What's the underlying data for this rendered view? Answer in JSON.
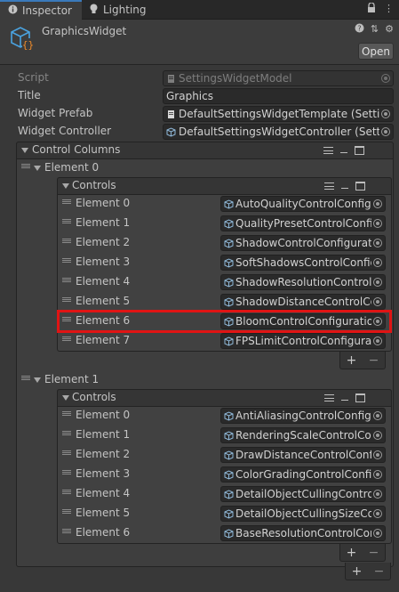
{
  "tabs": [
    {
      "label": "Inspector",
      "icon": "info-icon",
      "active": true
    },
    {
      "label": "Lighting",
      "icon": "lightbulb-icon",
      "active": false
    }
  ],
  "header": {
    "component_name": "GraphicsWidget",
    "open_label": "Open"
  },
  "properties": {
    "script_label": "Script",
    "script_value": "SettingsWidgetModel",
    "title_label": "Title",
    "title_value": "Graphics",
    "prefab_label": "Widget Prefab",
    "prefab_value": "DefaultSettingsWidgetTemplate (Setting",
    "controller_label": "Widget Controller",
    "controller_value": "DefaultSettingsWidgetController (Setting"
  },
  "control_columns": {
    "label": "Control Columns",
    "elements": [
      {
        "label": "Element 0",
        "controls_label": "Controls",
        "items": [
          {
            "label": "Element 0",
            "value": "AutoQualityControlConfigu"
          },
          {
            "label": "Element 1",
            "value": "QualityPresetControlConfig"
          },
          {
            "label": "Element 2",
            "value": "ShadowControlConfiguratio"
          },
          {
            "label": "Element 3",
            "value": "SoftShadowsControlConfig"
          },
          {
            "label": "Element 4",
            "value": "ShadowResolutionControlC"
          },
          {
            "label": "Element 5",
            "value": "ShadowDistanceControlCo"
          },
          {
            "label": "Element 6",
            "value": "BloomControlConfiguration"
          },
          {
            "label": "Element 7",
            "value": "FPSLimitControlConfigurati"
          }
        ]
      },
      {
        "label": "Element 1",
        "controls_label": "Controls",
        "items": [
          {
            "label": "Element 0",
            "value": "AntiAliasingControlConfigu"
          },
          {
            "label": "Element 1",
            "value": "RenderingScaleControlCon"
          },
          {
            "label": "Element 2",
            "value": "DrawDistanceControlConfi"
          },
          {
            "label": "Element 3",
            "value": "ColorGradingControlConfig"
          },
          {
            "label": "Element 4",
            "value": "DetailObjectCullingControl"
          },
          {
            "label": "Element 5",
            "value": "DetailObjectCullingSizeCor"
          },
          {
            "label": "Element 6",
            "value": "BaseResolutionControlCon"
          }
        ]
      }
    ]
  },
  "footer": {
    "plus": "+",
    "minus": "−"
  },
  "colors": {
    "accent": "#3a79bb",
    "highlight": "#e01414",
    "icon_blue": "#4aa3e0"
  }
}
